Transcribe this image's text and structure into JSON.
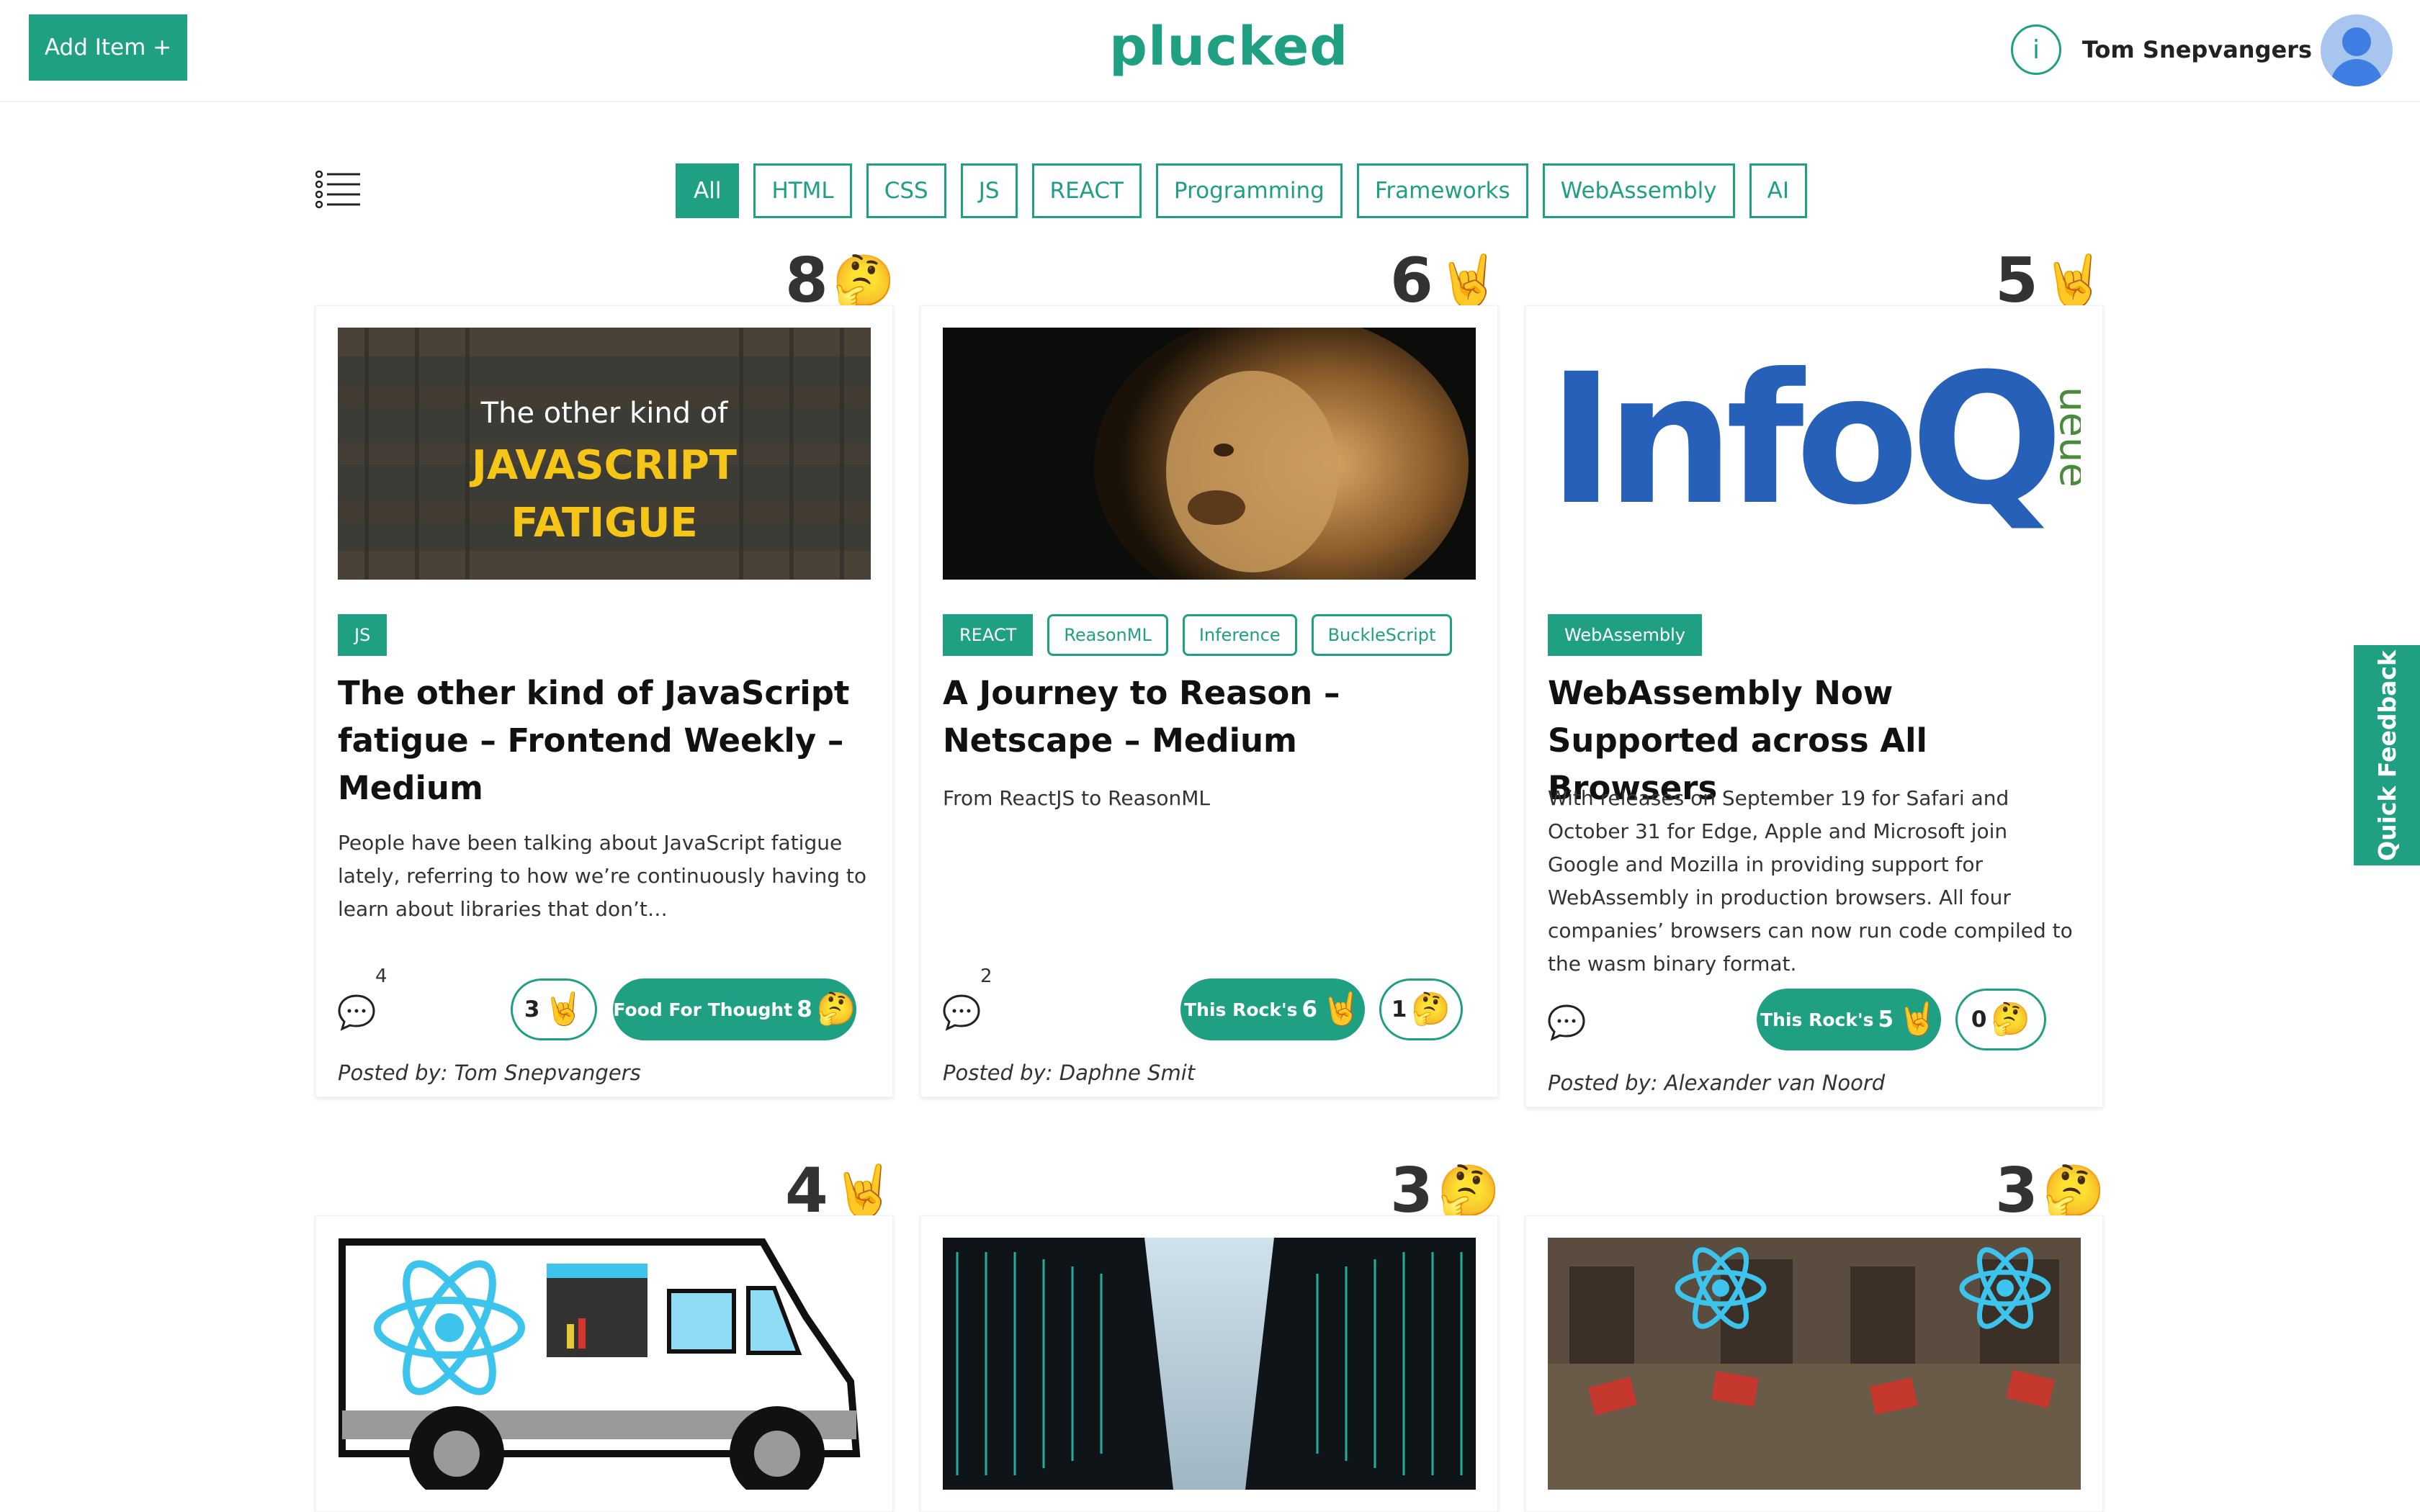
{
  "header": {
    "add_button": "Add Item +",
    "logo": "plucked",
    "info_label": "i",
    "user_name": "Tom Snepvangers"
  },
  "filters": [
    "All",
    "HTML",
    "CSS",
    "JS",
    "REACT",
    "Programming",
    "Frameworks",
    "WebAssembly",
    "AI"
  ],
  "active_filter": "All",
  "cards": [
    {
      "score": "8",
      "score_emoji": "🤔",
      "image_text": {
        "line1": "The other kind of",
        "line2": "JAVASCRIPT",
        "line3": "FATIGUE"
      },
      "tags": [
        "JS"
      ],
      "title": "The other kind of JavaScript fatigue – Frontend Weekly – Medium",
      "description": "People have been talking about JavaScript fatigue lately, referring to how we’re continuously having to learn about libraries that don’t…",
      "comment_count": "4",
      "rock_count": "3",
      "thought_label": "Food For Thought",
      "thought_count": "8",
      "posted_by": "Posted by: Tom Snepvangers"
    },
    {
      "score": "6",
      "score_emoji": "🤘",
      "tags": [
        "REACT",
        "ReasonML",
        "Inference",
        "BuckleScript"
      ],
      "title": "A Journey to Reason – Netscape – Medium",
      "description": "From ReactJS to ReasonML",
      "comment_count": "2",
      "rock_label": "This Rock's",
      "rock_count": "6",
      "thought_count": "1",
      "posted_by": "Posted by: Daphne Smit"
    },
    {
      "score": "5",
      "score_emoji": "🤘",
      "image_text": {
        "brand": "InfoQ",
        "side": "ueue"
      },
      "tags": [
        "WebAssembly"
      ],
      "title": "WebAssembly Now Supported across All Browsers",
      "description": "With releases on September 19 for Safari and October 31 for Edge, Apple and Microsoft join Google and Mozilla in providing support for WebAssembly in production browsers. All four companies’ browsers can now run code compiled to the wasm binary format.",
      "rock_label": "This Rock's",
      "rock_count": "5",
      "thought_count": "0",
      "posted_by": "Posted by: Alexander van Noord"
    },
    {
      "score": "4",
      "score_emoji": "🤘"
    },
    {
      "score": "3",
      "score_emoji": "🤔"
    },
    {
      "score": "3",
      "score_emoji": "🤔"
    }
  ],
  "quick_feedback": "Quick Feedback",
  "colors": {
    "accent": "#1fa082",
    "text": "#222222",
    "background": "#ffffff"
  },
  "icons": [
    "list-icon",
    "info-icon",
    "avatar-icon",
    "comment-icon",
    "rock-emoji",
    "thinking-emoji"
  ]
}
